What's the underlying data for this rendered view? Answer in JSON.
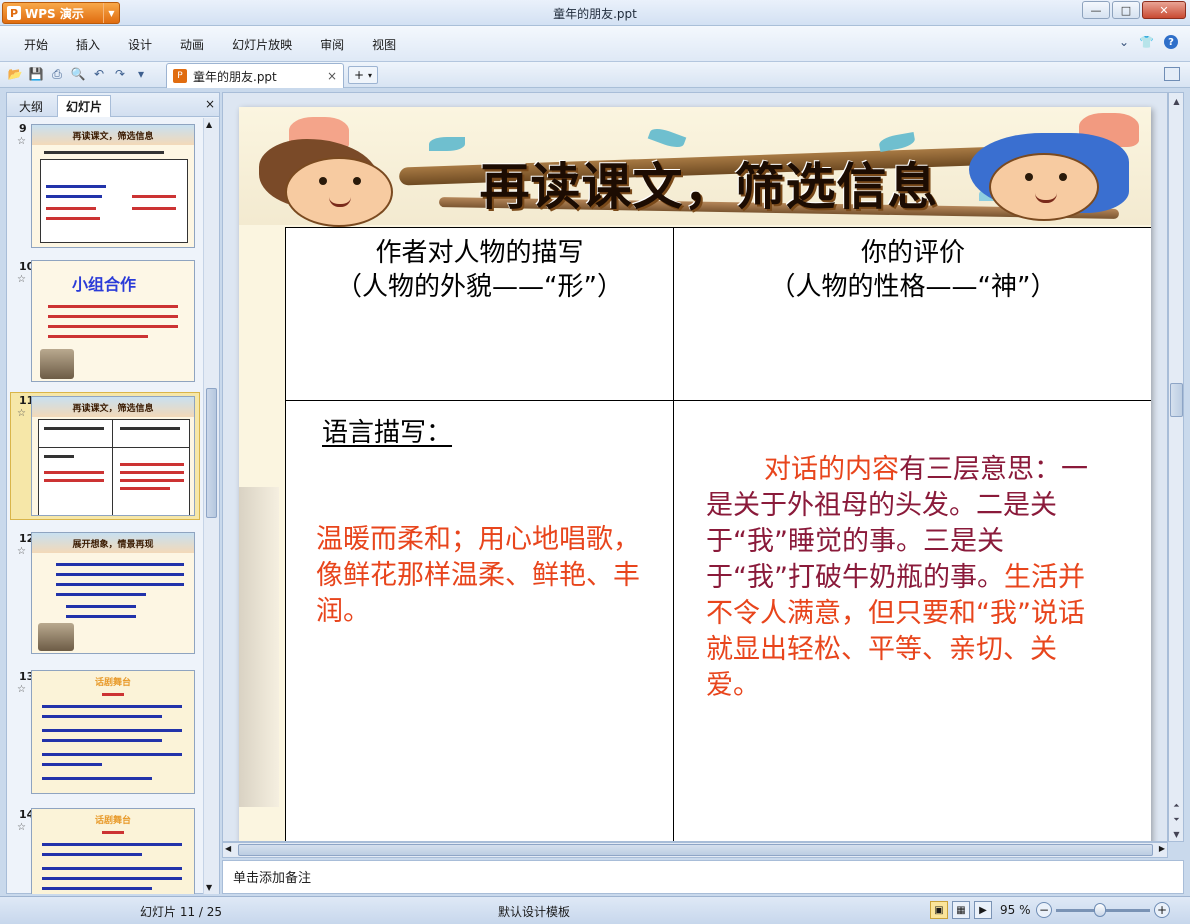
{
  "app": {
    "brand": "WPS 演示",
    "window_title": "童年的朋友.ppt"
  },
  "menu": [
    "开始",
    "插入",
    "设计",
    "动画",
    "幻灯片放映",
    "审阅",
    "视图"
  ],
  "doc_tab": {
    "label": "童年的朋友.ppt",
    "close": "×",
    "add": "+"
  },
  "left_panel": {
    "tabs": [
      "大纲",
      "幻灯片"
    ],
    "close": "×",
    "thumbnails": [
      {
        "num": "9",
        "title": "再读课文，筛选信息"
      },
      {
        "num": "10",
        "title": "小组合作"
      },
      {
        "num": "11",
        "title": "再读课文，筛选信息"
      },
      {
        "num": "12",
        "title": "展开想象，情景再现"
      },
      {
        "num": "13",
        "title": "话剧舞台"
      },
      {
        "num": "14",
        "title": "话剧舞台"
      }
    ]
  },
  "slide": {
    "banner_title": "再读课文，筛选信息",
    "table": {
      "header_left": [
        "作者对人物的描写",
        "（人物的外貌——“形”）"
      ],
      "header_right": [
        "你的评价",
        "（人物的性格——“神”）"
      ],
      "label_language": "语言描写：",
      "left_text": "温暖而柔和；用心地唱歌，像鲜花那样温柔、鲜艳、丰润。",
      "right_parts": [
        {
          "text": "对话的内容",
          "color": "red"
        },
        {
          "text": "有三层意思：一是关于外祖母的头发。二是关于“我”睡觉的事。三是关于“我”打破牛奶瓶的事。",
          "color": "dark"
        },
        {
          "text": "生活并不令人满意，但只要和“我”说话就显出轻松、平等、亲切、关爱。",
          "color": "red"
        }
      ]
    }
  },
  "notes": {
    "placeholder": "单击添加备注"
  },
  "status": {
    "slide_info": "幻灯片 11 / 25",
    "template": "默认设计模板",
    "zoom": "95 %"
  },
  "colors": {
    "accent_red": "#e8451c",
    "accent_dark": "#8a1a3a",
    "wps_orange": "#e06c10"
  }
}
